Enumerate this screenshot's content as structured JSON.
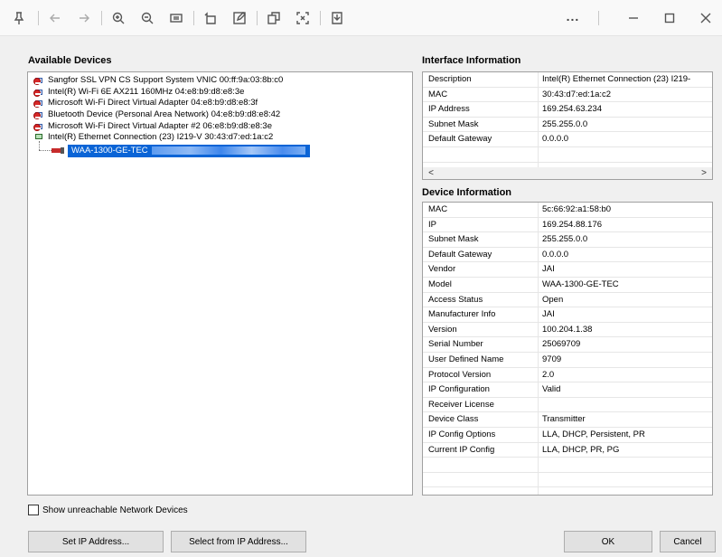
{
  "toolbar": {
    "icons": [
      "pin-icon",
      "back-arrow-icon",
      "forward-arrow-icon",
      "zoom-in-icon",
      "zoom-out-icon",
      "fit-page-icon",
      "rotate-icon",
      "edit-icon",
      "copy-icon",
      "capture-icon",
      "save-icon"
    ],
    "more_label": "...",
    "window_controls": [
      "minimize-icon",
      "maximize-icon",
      "close-icon"
    ]
  },
  "available_devices": {
    "title": "Available Devices",
    "items": [
      {
        "label": "Sangfor SSL VPN CS Support System VNIC 00:ff:9a:03:8b:c0",
        "status": "blocked"
      },
      {
        "label": "Intel(R) Wi-Fi 6E AX211 160MHz 04:e8:b9:d8:e8:3e",
        "status": "blocked"
      },
      {
        "label": "Microsoft Wi-Fi Direct Virtual Adapter 04:e8:b9:d8:e8:3f",
        "status": "blocked"
      },
      {
        "label": "Bluetooth Device (Personal Area Network) 04:e8:b9:d8:e8:42",
        "status": "blocked"
      },
      {
        "label": "Microsoft Wi-Fi Direct Virtual Adapter #2 06:e8:b9:d8:e8:3e",
        "status": "blocked"
      },
      {
        "label": "Intel(R) Ethernet Connection (23) I219-V 30:43:d7:ed:1a:c2",
        "status": "connected"
      }
    ],
    "child_device": {
      "label": "WAA-1300-GE-TEC",
      "selected": true
    }
  },
  "interface_information": {
    "title": "Interface Information",
    "rows": [
      {
        "key": "Description",
        "value": "Intel(R) Ethernet Connection (23) I219-"
      },
      {
        "key": "MAC",
        "value": "30:43:d7:ed:1a:c2"
      },
      {
        "key": "IP Address",
        "value": "169.254.63.234"
      },
      {
        "key": "Subnet Mask",
        "value": "255.255.0.0"
      },
      {
        "key": "Default Gateway",
        "value": "0.0.0.0"
      },
      {
        "key": "",
        "value": ""
      }
    ],
    "scroll_left": "<",
    "scroll_right": ">"
  },
  "device_information": {
    "title": "Device Information",
    "rows": [
      {
        "key": "MAC",
        "value": "5c:66:92:a1:58:b0"
      },
      {
        "key": "IP",
        "value": "169.254.88.176"
      },
      {
        "key": "Subnet Mask",
        "value": "255.255.0.0"
      },
      {
        "key": "Default Gateway",
        "value": "0.0.0.0"
      },
      {
        "key": "Vendor",
        "value": "JAI"
      },
      {
        "key": "Model",
        "value": "WAA-1300-GE-TEC"
      },
      {
        "key": "Access Status",
        "value": "Open"
      },
      {
        "key": "Manufacturer Info",
        "value": "JAI"
      },
      {
        "key": "Version",
        "value": "100.204.1.38"
      },
      {
        "key": "Serial Number",
        "value": "25069709"
      },
      {
        "key": "User Defined Name",
        "value": "9709"
      },
      {
        "key": "Protocol Version",
        "value": "2.0"
      },
      {
        "key": "IP Configuration",
        "value": "Valid"
      },
      {
        "key": "Receiver License",
        "value": ""
      },
      {
        "key": "Device Class",
        "value": "Transmitter"
      },
      {
        "key": "IP Config Options",
        "value": "LLA, DHCP, Persistent, PR"
      },
      {
        "key": "Current IP Config",
        "value": "LLA, DHCP, PR, PG"
      },
      {
        "key": "",
        "value": ""
      },
      {
        "key": "",
        "value": ""
      },
      {
        "key": "",
        "value": ""
      }
    ]
  },
  "show_unreachable": {
    "label": "Show unreachable Network Devices",
    "checked": false
  },
  "buttons": {
    "set_ip": "Set IP Address...",
    "select_from_ip": "Select from IP Address...",
    "ok": "OK",
    "cancel": "Cancel"
  }
}
